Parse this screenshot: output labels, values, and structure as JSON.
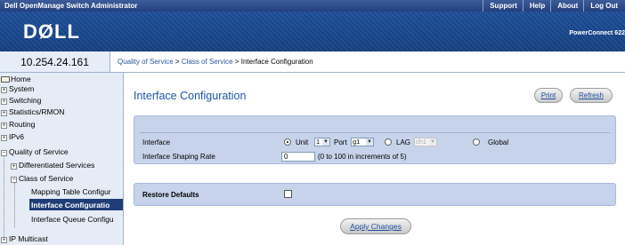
{
  "header": {
    "app_title": "Dell OpenManage Switch Administrator",
    "links": [
      "Support",
      "Help",
      "About",
      "Log Out"
    ],
    "logo": "DØLL",
    "product": "PowerConnect 622"
  },
  "ip_address": "10.254.24.161",
  "breadcrumb": {
    "links": [
      "Quality of Service",
      "Class of Service"
    ],
    "separator": " > ",
    "current": "Interface Configuration"
  },
  "sidebar": {
    "home": "Home",
    "items": [
      {
        "label": "System",
        "expander": "+"
      },
      {
        "label": "Switching",
        "expander": "+"
      },
      {
        "label": "Statistics/RMON",
        "expander": "+"
      },
      {
        "label": "Routing",
        "expander": "+"
      },
      {
        "label": "IPv6",
        "expander": "+"
      },
      {
        "label": "Quality of Service",
        "expander": "−"
      },
      {
        "label": "Differentiated Services",
        "expander": "+"
      },
      {
        "label": "Class of Service",
        "expander": "−"
      },
      {
        "label": "Mapping Table Configur"
      },
      {
        "label": "Interface Configuratio",
        "selected": true
      },
      {
        "label": "Interface Queue Configu"
      },
      {
        "label": "IP Multicast",
        "expander": "+"
      }
    ]
  },
  "main": {
    "title": "Interface Configuration",
    "print_label": "Print",
    "refresh_label": "Refresh",
    "interface_label": "Interface",
    "unit_label": "Unit",
    "unit_value": "1",
    "port_label": "Port",
    "port_value": "g1",
    "lag_label": "LAG",
    "lag_value": "ch1",
    "global_label": "Global",
    "selected_option": "Unit",
    "shaping_label": "Interface Shaping Rate",
    "shaping_value": "0",
    "shaping_hint": "(0 to 100 in increments of 5)",
    "restore_label": "Restore Defaults",
    "restore_checked": false,
    "apply_label": "Apply Changes"
  }
}
